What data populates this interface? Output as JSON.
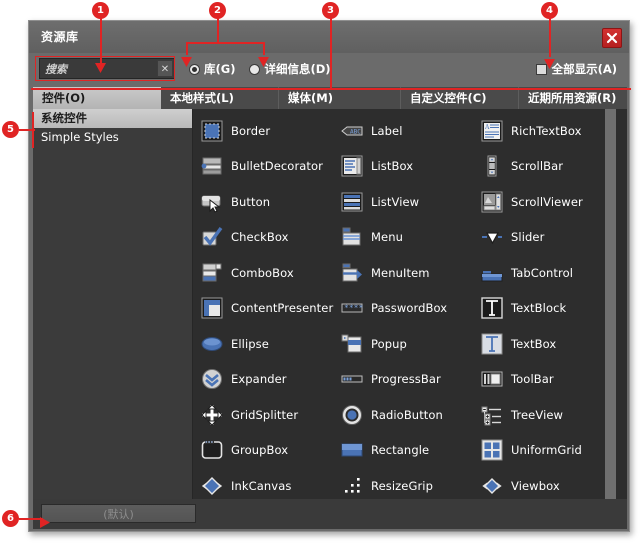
{
  "window": {
    "title": "资源库",
    "close_icon": "close-icon",
    "close_label": "✕"
  },
  "toolbar": {
    "search": {
      "value": "搜索",
      "placeholder": "搜索",
      "clear_label": "✕",
      "clear_icon": "clear-icon"
    },
    "radios": [
      {
        "label": "库(G)",
        "checked": true
      },
      {
        "label": "详细信息(D)",
        "checked": false
      }
    ],
    "show_all": {
      "label": "全部显示(A)",
      "checked": false
    }
  },
  "tabs": [
    {
      "label": "控件(O)",
      "active": true
    },
    {
      "label": "本地样式(L)",
      "active": false
    },
    {
      "label": "媒体(M)",
      "active": false
    },
    {
      "label": "自定义控件(C)",
      "active": false
    },
    {
      "label": "近期所用资源(R)",
      "active": false
    }
  ],
  "sidebar": {
    "items": [
      {
        "label": "系统控件",
        "selected": true
      },
      {
        "label": "Simple Styles",
        "selected": false
      }
    ]
  },
  "grid": {
    "columns": [
      {
        "items": [
          {
            "label": "Border",
            "icon": "border-icon"
          },
          {
            "label": "BulletDecorator",
            "icon": "bullet-decorator-icon"
          },
          {
            "label": "Button",
            "icon": "button-icon"
          },
          {
            "label": "CheckBox",
            "icon": "checkbox-icon"
          },
          {
            "label": "ComboBox",
            "icon": "combobox-icon"
          },
          {
            "label": "ContentPresenter",
            "icon": "content-presenter-icon"
          },
          {
            "label": "Ellipse",
            "icon": "ellipse-icon"
          },
          {
            "label": "Expander",
            "icon": "expander-icon"
          },
          {
            "label": "GridSplitter",
            "icon": "grid-splitter-icon"
          },
          {
            "label": "GroupBox",
            "icon": "groupbox-icon"
          },
          {
            "label": "InkCanvas",
            "icon": "ink-canvas-icon"
          }
        ]
      },
      {
        "items": [
          {
            "label": "Label",
            "icon": "label-icon"
          },
          {
            "label": "ListBox",
            "icon": "listbox-icon"
          },
          {
            "label": "ListView",
            "icon": "listview-icon"
          },
          {
            "label": "Menu",
            "icon": "menu-icon"
          },
          {
            "label": "MenuItem",
            "icon": "menuitem-icon"
          },
          {
            "label": "PasswordBox",
            "icon": "passwordbox-icon"
          },
          {
            "label": "Popup",
            "icon": "popup-icon"
          },
          {
            "label": "ProgressBar",
            "icon": "progressbar-icon"
          },
          {
            "label": "RadioButton",
            "icon": "radiobutton-icon"
          },
          {
            "label": "Rectangle",
            "icon": "rectangle-icon"
          },
          {
            "label": "ResizeGrip",
            "icon": "resize-grip-icon"
          }
        ]
      },
      {
        "items": [
          {
            "label": "RichTextBox",
            "icon": "richtextbox-icon"
          },
          {
            "label": "ScrollBar",
            "icon": "scrollbar-icon"
          },
          {
            "label": "ScrollViewer",
            "icon": "scrollviewer-icon"
          },
          {
            "label": "Slider",
            "icon": "slider-icon"
          },
          {
            "label": "TabControl",
            "icon": "tabcontrol-icon"
          },
          {
            "label": "TextBlock",
            "icon": "textblock-icon"
          },
          {
            "label": "TextBox",
            "icon": "textbox-icon"
          },
          {
            "label": "ToolBar",
            "icon": "toolbar-icon"
          },
          {
            "label": "TreeView",
            "icon": "treeview-icon"
          },
          {
            "label": "UniformGrid",
            "icon": "uniformgrid-icon"
          },
          {
            "label": "Viewbox",
            "icon": "viewbox-icon"
          }
        ]
      }
    ]
  },
  "footer": {
    "default_button": "(默认)"
  },
  "callouts": [
    {
      "number": "1"
    },
    {
      "number": "2"
    },
    {
      "number": "3"
    },
    {
      "number": "4"
    },
    {
      "number": "5"
    },
    {
      "number": "6"
    }
  ],
  "colors": {
    "accent_red": "#e02424",
    "window_chrome": "#6b6b6b",
    "panel_dark": "#2d2d2d",
    "sidebar": "#3b3b3b",
    "icon_blue": "#4a73b5"
  }
}
